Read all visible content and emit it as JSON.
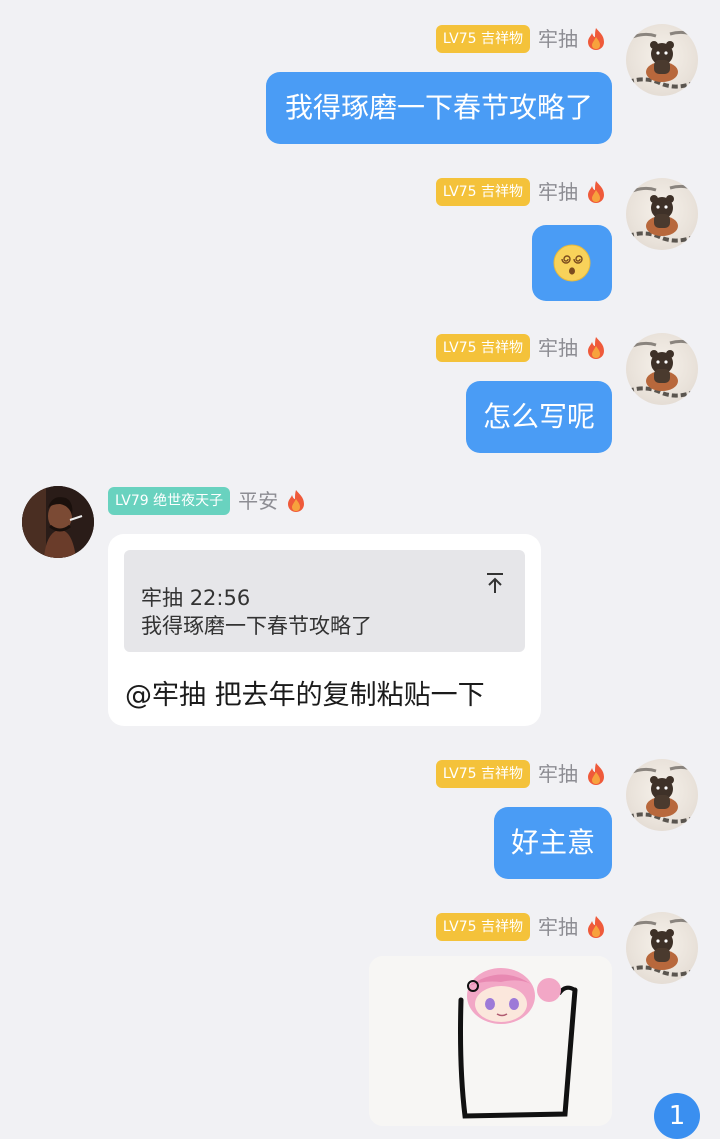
{
  "messages": [
    {
      "badge": "LV75 吉祥物",
      "nickname": "牢抽",
      "text": "我得琢磨一下春节攻略了"
    },
    {
      "badge": "LV75 吉祥物",
      "nickname": "牢抽",
      "emoji": "dizzy-face"
    },
    {
      "badge": "LV75 吉祥物",
      "nickname": "牢抽",
      "text": "怎么写呢"
    },
    {
      "badge": "LV79 绝世夜天子",
      "nickname": "平安",
      "quote": {
        "sender": "牢抽",
        "time": "22:56",
        "text": "我得琢磨一下春节攻略了"
      },
      "text": "@牢抽 把去年的复制粘贴一下"
    },
    {
      "badge": "LV75 吉祥物",
      "nickname": "牢抽",
      "text": "好主意"
    },
    {
      "badge": "LV75 吉祥物",
      "nickname": "牢抽",
      "sticker": "pink-hair-anime-girl-sticker"
    }
  ],
  "unread_count": "1",
  "colors": {
    "bubble_blue": "#4a9cf5",
    "badge_gold": "#f4c23a",
    "badge_teal": "#69d2bf",
    "unread_blue": "#3a8ff0"
  }
}
